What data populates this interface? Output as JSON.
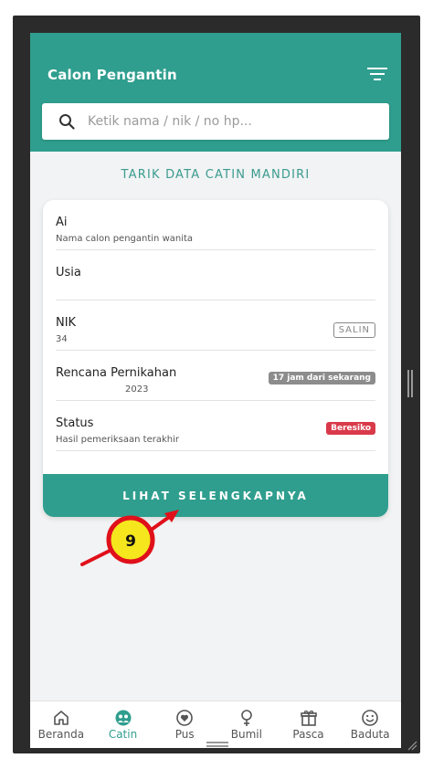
{
  "header": {
    "title": "Calon Pengantin",
    "filter_icon": "filter-icon"
  },
  "search": {
    "placeholder": "Ketik nama / nik / no hp..."
  },
  "pull_data_label": "TARIK DATA CATIN MANDIRI",
  "card": {
    "rows": [
      {
        "label": "Ai",
        "sub": "Nama calon pengantin wanita"
      },
      {
        "label": "Usia",
        "sub": ""
      },
      {
        "label": "NIK",
        "sub": "34",
        "badge": "SALIN"
      },
      {
        "label": "Rencana Pernikahan",
        "sub": "2023",
        "badge": "17 jam dari sekarang"
      },
      {
        "label": "Status",
        "sub": "Hasil pemeriksaan terakhir",
        "badge": "Beresiko"
      }
    ],
    "more_button": "LIHAT SELENGKAPNYA"
  },
  "annotation": {
    "step": "9"
  },
  "nav": [
    {
      "label": "Beranda",
      "icon": "home-icon"
    },
    {
      "label": "Catin",
      "icon": "couple-icon",
      "active": true
    },
    {
      "label": "Pus",
      "icon": "heart-circle-icon"
    },
    {
      "label": "Bumil",
      "icon": "female-icon"
    },
    {
      "label": "Pasca",
      "icon": "gift-icon"
    },
    {
      "label": "Baduta",
      "icon": "smile-icon"
    }
  ],
  "colors": {
    "primary": "#2f9e8e",
    "danger": "#d93a4a",
    "marker_fill": "#f5e61e",
    "marker_ring": "#e0101a"
  }
}
